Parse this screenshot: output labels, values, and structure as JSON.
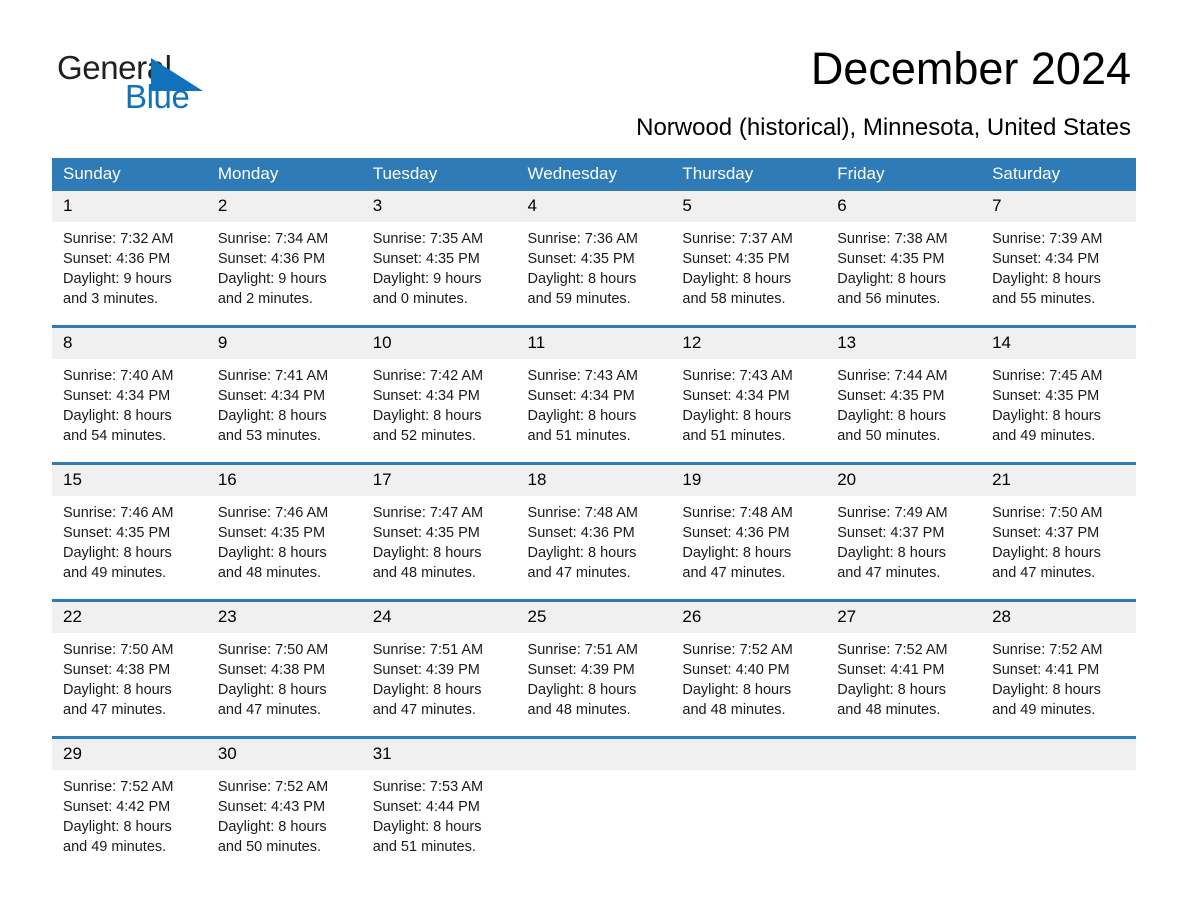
{
  "brand": {
    "name_part1": "General",
    "name_part2": "Blue",
    "triangle_color": "#1271bb",
    "text_color": "#231f20"
  },
  "header": {
    "month_title": "December 2024",
    "location": "Norwood (historical), Minnesota, United States"
  },
  "theme": {
    "header_blue": "#2e7bb8",
    "daynum_bg": "#f0f0f0",
    "cell_bg": "#ffffff",
    "text": "#000000"
  },
  "calendar": {
    "weekday_headers": [
      "Sunday",
      "Monday",
      "Tuesday",
      "Wednesday",
      "Thursday",
      "Friday",
      "Saturday"
    ],
    "weeks": [
      [
        {
          "day": "1",
          "sunrise": "Sunrise: 7:32 AM",
          "sunset": "Sunset: 4:36 PM",
          "daylight": "Daylight: 9 hours and 3 minutes."
        },
        {
          "day": "2",
          "sunrise": "Sunrise: 7:34 AM",
          "sunset": "Sunset: 4:36 PM",
          "daylight": "Daylight: 9 hours and 2 minutes."
        },
        {
          "day": "3",
          "sunrise": "Sunrise: 7:35 AM",
          "sunset": "Sunset: 4:35 PM",
          "daylight": "Daylight: 9 hours and 0 minutes."
        },
        {
          "day": "4",
          "sunrise": "Sunrise: 7:36 AM",
          "sunset": "Sunset: 4:35 PM",
          "daylight": "Daylight: 8 hours and 59 minutes."
        },
        {
          "day": "5",
          "sunrise": "Sunrise: 7:37 AM",
          "sunset": "Sunset: 4:35 PM",
          "daylight": "Daylight: 8 hours and 58 minutes."
        },
        {
          "day": "6",
          "sunrise": "Sunrise: 7:38 AM",
          "sunset": "Sunset: 4:35 PM",
          "daylight": "Daylight: 8 hours and 56 minutes."
        },
        {
          "day": "7",
          "sunrise": "Sunrise: 7:39 AM",
          "sunset": "Sunset: 4:34 PM",
          "daylight": "Daylight: 8 hours and 55 minutes."
        }
      ],
      [
        {
          "day": "8",
          "sunrise": "Sunrise: 7:40 AM",
          "sunset": "Sunset: 4:34 PM",
          "daylight": "Daylight: 8 hours and 54 minutes."
        },
        {
          "day": "9",
          "sunrise": "Sunrise: 7:41 AM",
          "sunset": "Sunset: 4:34 PM",
          "daylight": "Daylight: 8 hours and 53 minutes."
        },
        {
          "day": "10",
          "sunrise": "Sunrise: 7:42 AM",
          "sunset": "Sunset: 4:34 PM",
          "daylight": "Daylight: 8 hours and 52 minutes."
        },
        {
          "day": "11",
          "sunrise": "Sunrise: 7:43 AM",
          "sunset": "Sunset: 4:34 PM",
          "daylight": "Daylight: 8 hours and 51 minutes."
        },
        {
          "day": "12",
          "sunrise": "Sunrise: 7:43 AM",
          "sunset": "Sunset: 4:34 PM",
          "daylight": "Daylight: 8 hours and 51 minutes."
        },
        {
          "day": "13",
          "sunrise": "Sunrise: 7:44 AM",
          "sunset": "Sunset: 4:35 PM",
          "daylight": "Daylight: 8 hours and 50 minutes."
        },
        {
          "day": "14",
          "sunrise": "Sunrise: 7:45 AM",
          "sunset": "Sunset: 4:35 PM",
          "daylight": "Daylight: 8 hours and 49 minutes."
        }
      ],
      [
        {
          "day": "15",
          "sunrise": "Sunrise: 7:46 AM",
          "sunset": "Sunset: 4:35 PM",
          "daylight": "Daylight: 8 hours and 49 minutes."
        },
        {
          "day": "16",
          "sunrise": "Sunrise: 7:46 AM",
          "sunset": "Sunset: 4:35 PM",
          "daylight": "Daylight: 8 hours and 48 minutes."
        },
        {
          "day": "17",
          "sunrise": "Sunrise: 7:47 AM",
          "sunset": "Sunset: 4:35 PM",
          "daylight": "Daylight: 8 hours and 48 minutes."
        },
        {
          "day": "18",
          "sunrise": "Sunrise: 7:48 AM",
          "sunset": "Sunset: 4:36 PM",
          "daylight": "Daylight: 8 hours and 47 minutes."
        },
        {
          "day": "19",
          "sunrise": "Sunrise: 7:48 AM",
          "sunset": "Sunset: 4:36 PM",
          "daylight": "Daylight: 8 hours and 47 minutes."
        },
        {
          "day": "20",
          "sunrise": "Sunrise: 7:49 AM",
          "sunset": "Sunset: 4:37 PM",
          "daylight": "Daylight: 8 hours and 47 minutes."
        },
        {
          "day": "21",
          "sunrise": "Sunrise: 7:50 AM",
          "sunset": "Sunset: 4:37 PM",
          "daylight": "Daylight: 8 hours and 47 minutes."
        }
      ],
      [
        {
          "day": "22",
          "sunrise": "Sunrise: 7:50 AM",
          "sunset": "Sunset: 4:38 PM",
          "daylight": "Daylight: 8 hours and 47 minutes."
        },
        {
          "day": "23",
          "sunrise": "Sunrise: 7:50 AM",
          "sunset": "Sunset: 4:38 PM",
          "daylight": "Daylight: 8 hours and 47 minutes."
        },
        {
          "day": "24",
          "sunrise": "Sunrise: 7:51 AM",
          "sunset": "Sunset: 4:39 PM",
          "daylight": "Daylight: 8 hours and 47 minutes."
        },
        {
          "day": "25",
          "sunrise": "Sunrise: 7:51 AM",
          "sunset": "Sunset: 4:39 PM",
          "daylight": "Daylight: 8 hours and 48 minutes."
        },
        {
          "day": "26",
          "sunrise": "Sunrise: 7:52 AM",
          "sunset": "Sunset: 4:40 PM",
          "daylight": "Daylight: 8 hours and 48 minutes."
        },
        {
          "day": "27",
          "sunrise": "Sunrise: 7:52 AM",
          "sunset": "Sunset: 4:41 PM",
          "daylight": "Daylight: 8 hours and 48 minutes."
        },
        {
          "day": "28",
          "sunrise": "Sunrise: 7:52 AM",
          "sunset": "Sunset: 4:41 PM",
          "daylight": "Daylight: 8 hours and 49 minutes."
        }
      ],
      [
        {
          "day": "29",
          "sunrise": "Sunrise: 7:52 AM",
          "sunset": "Sunset: 4:42 PM",
          "daylight": "Daylight: 8 hours and 49 minutes."
        },
        {
          "day": "30",
          "sunrise": "Sunrise: 7:52 AM",
          "sunset": "Sunset: 4:43 PM",
          "daylight": "Daylight: 8 hours and 50 minutes."
        },
        {
          "day": "31",
          "sunrise": "Sunrise: 7:53 AM",
          "sunset": "Sunset: 4:44 PM",
          "daylight": "Daylight: 8 hours and 51 minutes."
        },
        {
          "day": "",
          "sunrise": "",
          "sunset": "",
          "daylight": ""
        },
        {
          "day": "",
          "sunrise": "",
          "sunset": "",
          "daylight": ""
        },
        {
          "day": "",
          "sunrise": "",
          "sunset": "",
          "daylight": ""
        },
        {
          "day": "",
          "sunrise": "",
          "sunset": "",
          "daylight": ""
        }
      ]
    ]
  }
}
